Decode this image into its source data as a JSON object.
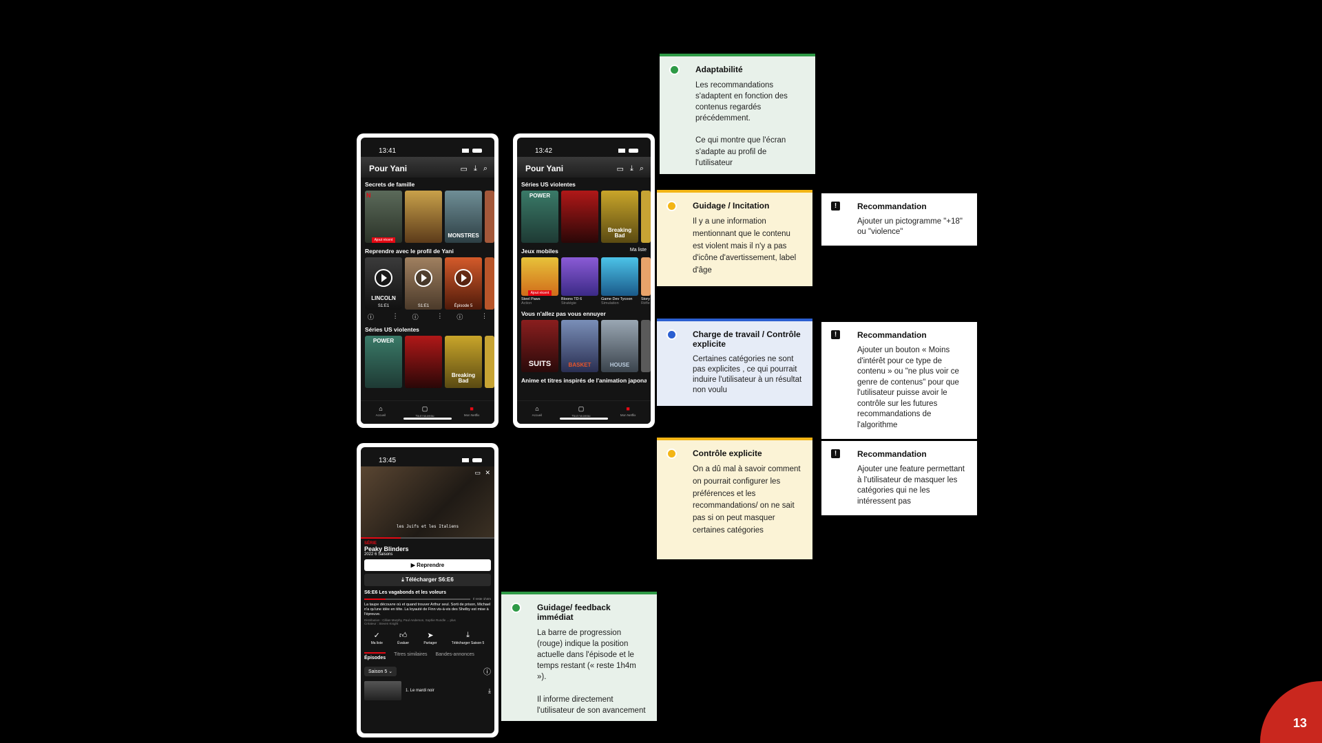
{
  "phone1": {
    "time": "13:41",
    "title": "Pour Yani",
    "sections": [
      {
        "title": "Secrets de famille",
        "posters": [
          "",
          "",
          "MONSTRES",
          ""
        ],
        "new_tag": "Ajout récent"
      },
      {
        "title": "Reprendre avec le profil de Yani",
        "posters": [
          "LINCOLN",
          "",
          ""
        ],
        "episodes": [
          "S1:E1",
          "S1:E1",
          "Épisode 5"
        ]
      },
      {
        "title": "Séries US violentes",
        "posters": [
          "POWER",
          "",
          "Breaking Bad",
          ""
        ]
      }
    ],
    "tabs": [
      "Accueil",
      "Tout nouveau",
      "Mon Netflix"
    ]
  },
  "phone2": {
    "time": "13:42",
    "title": "Pour Yani",
    "sections": [
      {
        "title": "Séries US violentes",
        "posters": [
          "POWER",
          "",
          "Breaking Bad",
          ""
        ]
      },
      {
        "title": "Jeux mobiles",
        "more": "Ma liste",
        "new_tag": "Ajout récent",
        "games": [
          {
            "name": "Steel Paws",
            "genre": "Action"
          },
          {
            "name": "Bloons TD 6",
            "genre": "Stratégie"
          },
          {
            "name": "Game Dev Tycoon",
            "genre": "Simulation"
          },
          {
            "name": "Story",
            "genre": "Réfle"
          }
        ]
      },
      {
        "title": "Vous n'allez pas vous ennuyer",
        "posters": [
          "SUITS",
          "BASKET",
          "HOUSE",
          ""
        ]
      },
      {
        "title": "Anime et titres inspirés de l'animation japonaise"
      }
    ],
    "tabs": [
      "Accueil",
      "Tout nouveau",
      "Mon Netflix"
    ]
  },
  "phone3": {
    "time": "13:45",
    "subtitle": "les Juifs et les Italiens",
    "series_label": "SÉRIE",
    "show_title": "Peaky Blinders",
    "meta": "2022  6 Saisons",
    "resume": "Reprendre",
    "download": "Télécharger S6:E6",
    "episode_title": "S6:E6 Les vagabonds et les voleurs",
    "remaining": "Il reste 1h4m",
    "synopsis": "La taupe découvre où et quand trouver Arthur seul. Sorti de prison, Michael n'a qu'une idée en tête. La loyauté de Finn vis-à-vis des Shelby est mise à l'épreuve.",
    "cast": "Distribution : Cillian Murphy, Paul Anderson, Sophie Rundle ... plus",
    "creator": "Créateur : Steven Knight",
    "actions": [
      "Ma liste",
      "Évaluer",
      "Partager",
      "Télécharger Saison 5"
    ],
    "tabs": [
      "Épisodes",
      "Titres similaires",
      "Bandes-annonces"
    ],
    "season": "Saison 5",
    "first_episode": "1. Le mardi noir"
  },
  "cards": {
    "adaptabilite": {
      "title": "Adaptabilité",
      "body": "Les recommandations s'adaptent en fonction des contenus regardés précédemment.\n\nCe qui montre que l'écran s'adapte au profil de l'utilisateur"
    },
    "guidage": {
      "title": "Guidage / Incitation",
      "body": "Il y a une information mentionnant que le contenu est violent mais il n'y a pas d'icône d'avertissement, label d'âge"
    },
    "reco1": {
      "title": "Recommandation",
      "body": "Ajouter un pictogramme \"+18\" ou \"violence\""
    },
    "charge": {
      "title": "Charge de travail / Contrôle explicite",
      "body": "Certaines catégories ne sont pas explicites , ce qui pourrait induire l'utilisateur à un résultat non voulu"
    },
    "reco2": {
      "title": "Recommandation",
      "body": "Ajouter un bouton « Moins d'intérêt pour ce type de contenu » ou \"ne plus voir ce genre de contenus\" pour que l'utilisateur puisse avoir le contrôle sur les futures recommandations de l'algorithme"
    },
    "controle": {
      "title": "Contrôle explicite",
      "body": "On a dû mal à savoir comment on pourrait configurer les préférences et les recommandations/ on ne sait pas si on peut masquer certaines catégories"
    },
    "reco3": {
      "title": "Recommandation",
      "body": "Ajouter une feature permettant à l'utilisateur de masquer les catégories qui ne les intéressent pas"
    },
    "feedback": {
      "title": "Guidage/ feedback immédiat",
      "body": "La barre de progression (rouge) indique la position actuelle dans l'épisode et le temps restant (« reste 1h4m »).\n\nIl informe directement l'utilisateur de son avancement"
    }
  },
  "page_number": "13",
  "colors": {
    "green": "#2e9a46",
    "yellow": "#f3b515",
    "blue": "#2b5fd1",
    "netflix_red": "#e50914",
    "corner": "#c9271e"
  }
}
